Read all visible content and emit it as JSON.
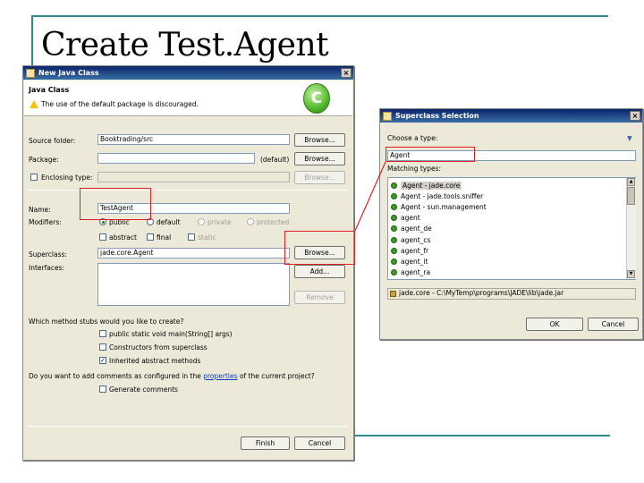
{
  "slide": {
    "title": "Create Test.Agent"
  },
  "new_java_class": {
    "window_title": "New Java Class",
    "header": {
      "title": "Java Class",
      "warning": "The use of the default package is discouraged."
    },
    "source_folder": {
      "label": "Source folder:",
      "value": "Booktrading/src",
      "browse": "Browse..."
    },
    "package": {
      "label": "Package:",
      "value": "",
      "default_hint": "(default)",
      "browse": "Browse..."
    },
    "enclosing_type": {
      "label": "Enclosing type:",
      "value": "",
      "browse": "Browse..."
    },
    "name": {
      "label": "Name:",
      "value": "TestAgent"
    },
    "modifiers": {
      "label": "Modifiers:",
      "public": "public",
      "default": "default",
      "private": "private",
      "protected": "protected",
      "abstract": "abstract",
      "final": "final",
      "static": "static"
    },
    "superclass": {
      "label": "Superclass:",
      "value": "jade.core.Agent",
      "browse": "Browse..."
    },
    "interfaces": {
      "label": "Interfaces:",
      "add": "Add...",
      "remove": "Remove"
    },
    "stubs_question": "Which method stubs would you like to create?",
    "stubs": {
      "main": "public static void main(String[] args)",
      "constructors": "Constructors from superclass",
      "inherited": "Inherited abstract methods"
    },
    "comments_question": {
      "before": "Do you want to add comments as configured in the",
      "link": "properties",
      "after": "of the current project?"
    },
    "generate_comments": "Generate comments",
    "finish": "Finish",
    "cancel": "Cancel"
  },
  "superclass_selection": {
    "window_title": "Superclass Selection",
    "choose_label": "Choose a type:",
    "search_value": "Agent",
    "matching_label": "Matching types:",
    "items": [
      "Agent - jade.core",
      "Agent - jade.tools.sniffer",
      "Agent - sun.management",
      "agent",
      "agent_de",
      "agent_cs",
      "agent_fr",
      "agent_it",
      "agent_ra"
    ],
    "location": "jade.core - C:\\MyTemp\\programs\\JADE\\lib\\jade.jar",
    "ok": "OK",
    "cancel": "Cancel"
  },
  "colors": {
    "accent": "#2e8b8b",
    "annotation": "#e02020",
    "title_bar": "#0a246a"
  }
}
